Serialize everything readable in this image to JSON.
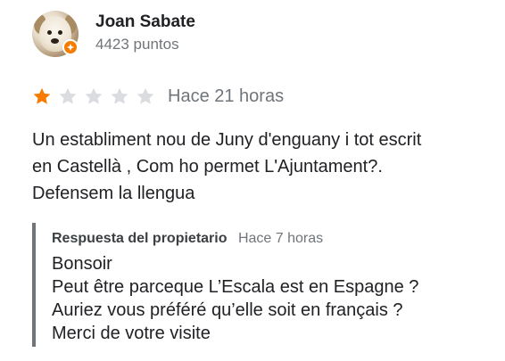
{
  "reviewer": {
    "name": "Joan Sabate",
    "points": "4423 puntos",
    "avatar_icon": "dog-avatar",
    "badge_icon": "local-guide-badge-icon",
    "badge_color": "#f57c00"
  },
  "rating": {
    "value": 1,
    "max": 5,
    "filled_color": "#f57c00",
    "empty_color": "#dadce0",
    "time": "Hace 21 horas"
  },
  "review": {
    "lines": [
      "Un establiment nou de Juny d'enguany i tot escrit",
      "en Castellà , Com ho permet L'Ajuntament?.",
      "Defensem la llengua"
    ]
  },
  "owner_reply": {
    "label": "Respuesta del propietario",
    "time": "Hace 7 horas",
    "lines": [
      "Bonsoir",
      "Peut être parceque L’Escala est en Espagne ?",
      "Auriez vous préféré qu’elle soit en français ?",
      "Merci de votre visite"
    ]
  }
}
